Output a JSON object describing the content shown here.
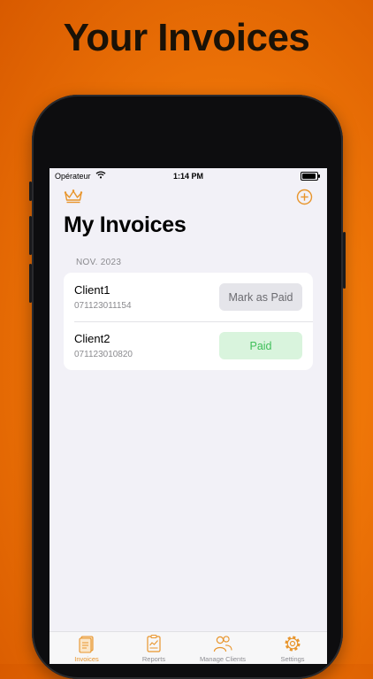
{
  "headline": "Your Invoices",
  "status_bar": {
    "carrier": "Opérateur",
    "time": "1:14 PM",
    "battery_level": 1.0
  },
  "nav": {
    "left_icon": "crown-icon",
    "right_icon": "add-circle-icon",
    "title": "My Invoices"
  },
  "section": {
    "header": "NOV. 2023",
    "invoices": [
      {
        "client": "Client1",
        "number": "071123011154",
        "action": "Mark as Paid",
        "status": "unpaid"
      },
      {
        "client": "Client2",
        "number": "071123010820",
        "action": "Paid",
        "status": "paid"
      }
    ]
  },
  "tabbar": {
    "tabs": [
      {
        "label": "Invoices",
        "icon": "invoice-document-icon",
        "active": true
      },
      {
        "label": "Reports",
        "icon": "report-clipboard-icon",
        "active": false
      },
      {
        "label": "Manage Clients",
        "icon": "people-icon",
        "active": false
      },
      {
        "label": "Settings",
        "icon": "gear-icon",
        "active": false
      }
    ]
  },
  "colors": {
    "accent": "#e8952c",
    "paid_text": "#3fbf59",
    "paid_bg": "#d9f4dd",
    "background_orange": "#ef7608"
  }
}
